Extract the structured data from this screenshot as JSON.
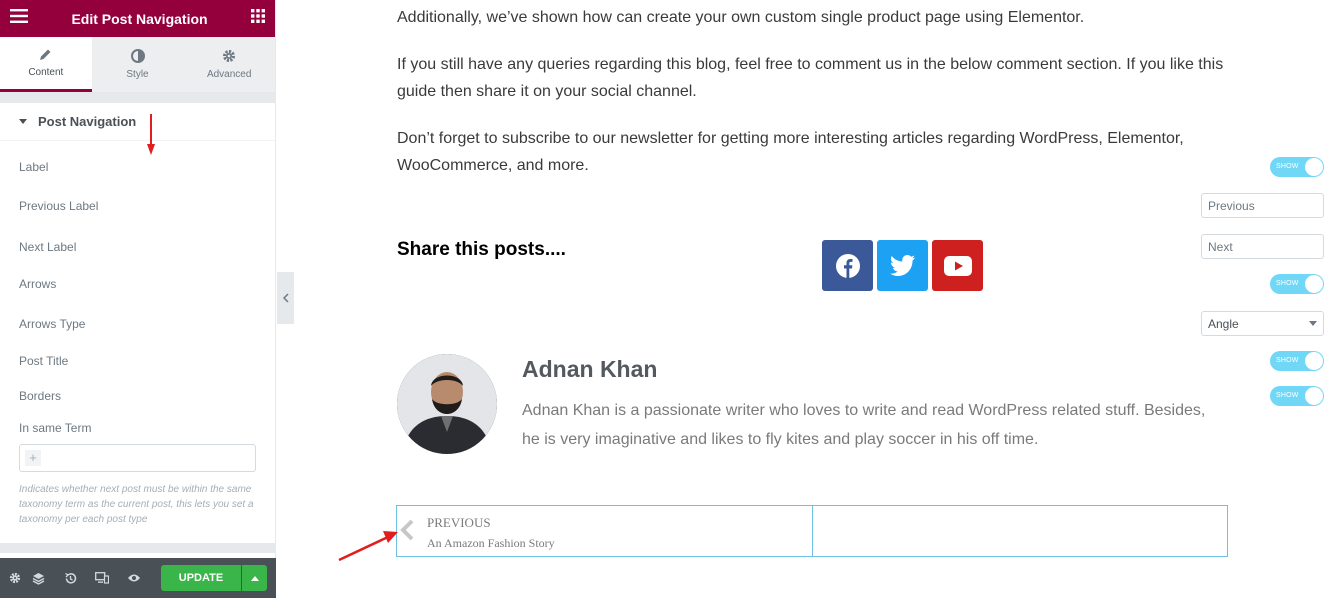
{
  "editor": {
    "title": "Edit Post Navigation",
    "tabs": [
      {
        "label": "Content",
        "icon": "pencil-icon"
      },
      {
        "label": "Style",
        "icon": "half-circle-icon"
      },
      {
        "label": "Advanced",
        "icon": "gear-icon"
      }
    ],
    "section_title": "Post Navigation",
    "controls": {
      "label": {
        "label": "Label",
        "toggle": "SHOW"
      },
      "previous_label": {
        "label": "Previous Label",
        "value": "Previous"
      },
      "next_label": {
        "label": "Next Label",
        "value": "Next"
      },
      "arrows": {
        "label": "Arrows",
        "toggle": "SHOW"
      },
      "arrows_type": {
        "label": "Arrows Type",
        "value": "Angle"
      },
      "post_title": {
        "label": "Post Title",
        "toggle": "SHOW"
      },
      "borders": {
        "label": "Borders",
        "toggle": "SHOW"
      },
      "in_same_term": {
        "label": "In same Term"
      }
    },
    "help_text": "Indicates whether next post must be within the same taxonomy term as the current post, this lets you set a taxonomy per each post type",
    "update_label": "UPDATE",
    "colors": {
      "brand": "#93003c",
      "toggle": "#71d7f7",
      "update": "#39b54a",
      "bottombar": "#495157"
    }
  },
  "article": {
    "paragraphs": [
      "Additionally, we’ve shown how can create your own custom single product page using Elementor.",
      "If you still have any queries regarding this blog, feel free to comment us in the below comment section. If you like this guide then share it on your social channel.",
      "Don’t forget to subscribe to our newsletter for getting more interesting articles regarding WordPress, Elementor, WooCommerce, and more."
    ],
    "share_title": "Share this posts....",
    "social": [
      {
        "name": "facebook-icon",
        "color": "#3b5998"
      },
      {
        "name": "twitter-icon",
        "color": "#1da1f2"
      },
      {
        "name": "youtube-icon",
        "color": "#cd201f"
      }
    ],
    "author": {
      "name": "Adnan Khan",
      "bio": "Adnan Khan is a passionate writer who loves to write and read WordPress related stuff. Besides, he is very imaginative and likes to fly kites and play soccer in his off time."
    },
    "post_nav": {
      "prev_label": "Previous",
      "prev_title": "An Amazon Fashion Story"
    }
  }
}
